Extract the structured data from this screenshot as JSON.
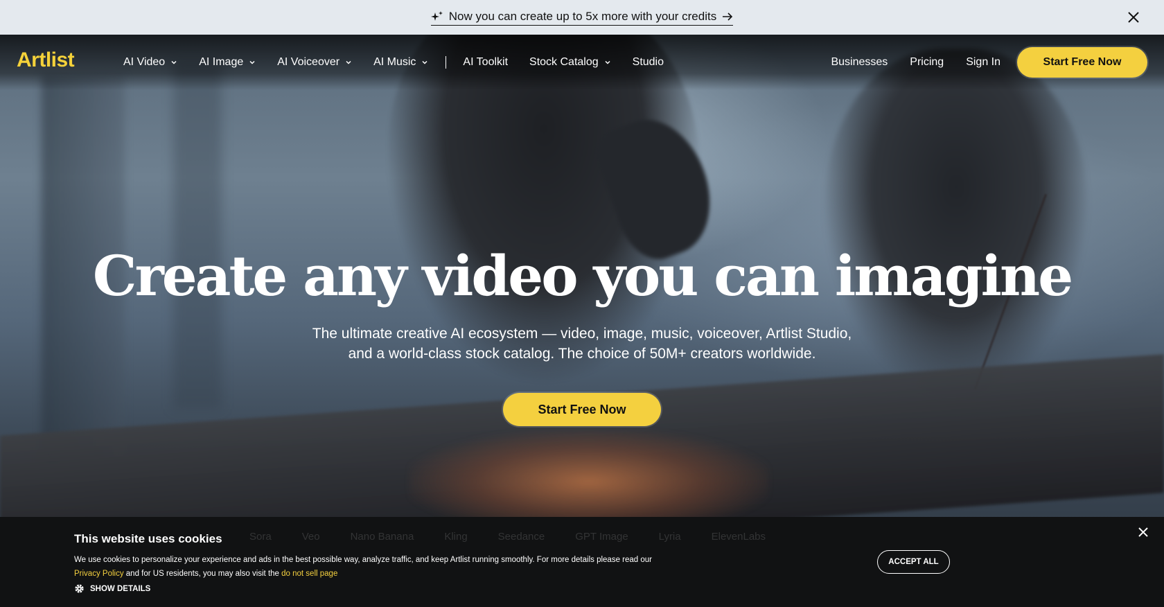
{
  "announcement": {
    "text": "Now you can create up to 5x more with your credits"
  },
  "nav": {
    "logo": "Artlist",
    "left_items": [
      {
        "label": "AI Video",
        "dropdown": true
      },
      {
        "label": "AI Image",
        "dropdown": true
      },
      {
        "label": "AI Voiceover",
        "dropdown": true
      },
      {
        "label": "AI Music",
        "dropdown": true
      },
      {
        "label": "AI Toolkit",
        "dropdown": false
      },
      {
        "label": "Stock Catalog",
        "dropdown": true
      },
      {
        "label": "Studio",
        "dropdown": false
      }
    ],
    "right_items": [
      {
        "label": "Businesses"
      },
      {
        "label": "Pricing"
      },
      {
        "label": "Sign In"
      }
    ],
    "cta_label": "Start Free Now"
  },
  "hero": {
    "title": "Create any video you can imagine",
    "subtitle_line1": "The ultimate creative AI ecosystem — video, image, music, voiceover, Artlist Studio,",
    "subtitle_line2": "and a world-class stock catalog. The choice of 50M+ creators worldwide.",
    "cta_label": "Start Free Now"
  },
  "models_strip": [
    "Sora",
    "Veo",
    "Nano Banana",
    "Kling",
    "Seedance",
    "GPT Image",
    "Lyria",
    "ElevenLabs"
  ],
  "cookie": {
    "title": "This website uses cookies",
    "text": "We use cookies to personalize your experience and ads in the best possible way, analyze traffic, and keep Artlist running smoothly. For more details please read our",
    "privacy_link": "Privacy Policy",
    "middle_text": "and for US residents, you may also visit the",
    "dnsp_link": "do not sell page",
    "show_details": "SHOW DETAILS",
    "accept_label": "ACCEPT ALL"
  },
  "colors": {
    "brand_yellow": "#f4d03f",
    "announce_bg": "#e4e9ee",
    "cookie_bg": "#111213"
  }
}
